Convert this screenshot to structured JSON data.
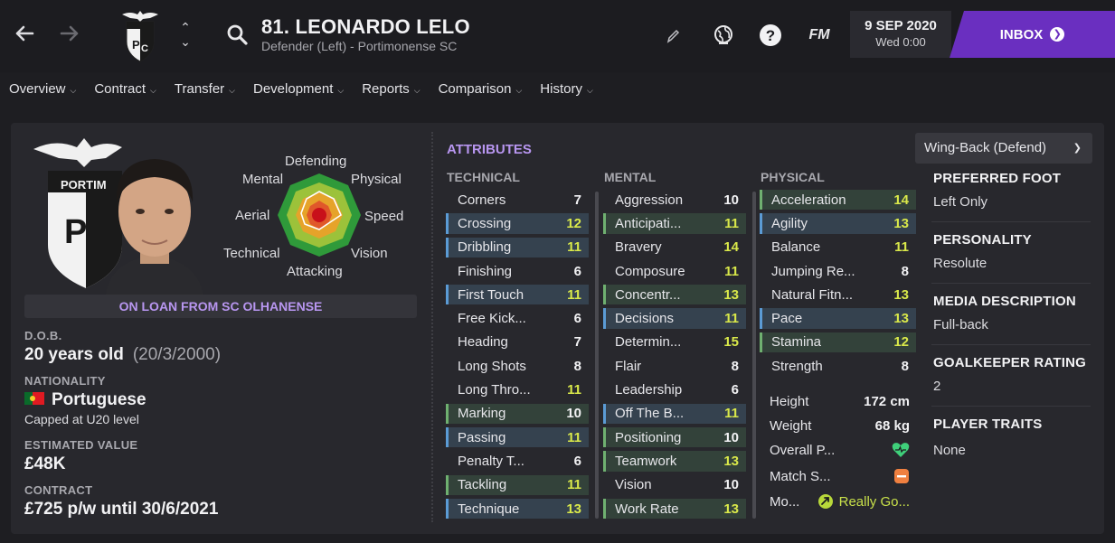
{
  "header": {
    "player_title": "81. LEONARDO LELO",
    "player_sub": "Defender (Left) - Portimonense SC",
    "back_icon": "arrow-left-icon",
    "forward_icon": "arrow-right-icon",
    "fm_label": "FM",
    "date": "9 SEP 2020",
    "time": "Wed 0:00",
    "inbox_label": "INBOX"
  },
  "menu": [
    {
      "label": "Overview"
    },
    {
      "label": "Contract"
    },
    {
      "label": "Transfer"
    },
    {
      "label": "Development"
    },
    {
      "label": "Reports"
    },
    {
      "label": "Comparison"
    },
    {
      "label": "History"
    }
  ],
  "radar": {
    "labels": {
      "defending": "Defending",
      "mental": "Mental",
      "physical": "Physical",
      "aerial": "Aerial",
      "speed": "Speed",
      "technical": "Technical",
      "vision": "Vision",
      "attacking": "Attacking"
    }
  },
  "profile": {
    "loan_text": "ON LOAN FROM SC OLHANENSE",
    "dob_label": "D.O.B.",
    "age": "20 years old",
    "dob": "(20/3/2000)",
    "nationality_label": "NATIONALITY",
    "nationality": "Portuguese",
    "capped": "Capped at U20 level",
    "value_label": "ESTIMATED VALUE",
    "value": "£48K",
    "contract_label": "CONTRACT",
    "contract": "£725 p/w until 30/6/2021"
  },
  "attributes": {
    "title": "ATTRIBUTES",
    "technical_label": "TECHNICAL",
    "mental_label": "MENTAL",
    "physical_label": "PHYSICAL",
    "technical": [
      {
        "name": "Corners",
        "value": "7",
        "hl": "",
        "c": "white"
      },
      {
        "name": "Crossing",
        "value": "12",
        "hl": "blue",
        "c": "yellow"
      },
      {
        "name": "Dribbling",
        "value": "11",
        "hl": "blue",
        "c": "yellow"
      },
      {
        "name": "Finishing",
        "value": "6",
        "hl": "",
        "c": "white"
      },
      {
        "name": "First Touch",
        "value": "11",
        "hl": "blue",
        "c": "yellow"
      },
      {
        "name": "Free Kick...",
        "value": "6",
        "hl": "",
        "c": "white"
      },
      {
        "name": "Heading",
        "value": "7",
        "hl": "",
        "c": "white"
      },
      {
        "name": "Long Shots",
        "value": "8",
        "hl": "",
        "c": "white"
      },
      {
        "name": "Long Thro...",
        "value": "11",
        "hl": "",
        "c": "yellow"
      },
      {
        "name": "Marking",
        "value": "10",
        "hl": "green",
        "c": "white"
      },
      {
        "name": "Passing",
        "value": "11",
        "hl": "blue",
        "c": "yellow"
      },
      {
        "name": "Penalty T...",
        "value": "6",
        "hl": "",
        "c": "white"
      },
      {
        "name": "Tackling",
        "value": "11",
        "hl": "green",
        "c": "yellow"
      },
      {
        "name": "Technique",
        "value": "13",
        "hl": "blue",
        "c": "yellow"
      }
    ],
    "mental": [
      {
        "name": "Aggression",
        "value": "10",
        "hl": "",
        "c": "white"
      },
      {
        "name": "Anticipati...",
        "value": "11",
        "hl": "green",
        "c": "yellow"
      },
      {
        "name": "Bravery",
        "value": "14",
        "hl": "",
        "c": "yellow"
      },
      {
        "name": "Composure",
        "value": "11",
        "hl": "",
        "c": "yellow"
      },
      {
        "name": "Concentr...",
        "value": "13",
        "hl": "green",
        "c": "yellow"
      },
      {
        "name": "Decisions",
        "value": "11",
        "hl": "blue",
        "c": "yellow"
      },
      {
        "name": "Determin...",
        "value": "15",
        "hl": "",
        "c": "yellow"
      },
      {
        "name": "Flair",
        "value": "8",
        "hl": "",
        "c": "white"
      },
      {
        "name": "Leadership",
        "value": "6",
        "hl": "",
        "c": "white"
      },
      {
        "name": "Off The B...",
        "value": "11",
        "hl": "blue",
        "c": "yellow"
      },
      {
        "name": "Positioning",
        "value": "10",
        "hl": "green",
        "c": "white"
      },
      {
        "name": "Teamwork",
        "value": "13",
        "hl": "green",
        "c": "yellow"
      },
      {
        "name": "Vision",
        "value": "10",
        "hl": "",
        "c": "white"
      },
      {
        "name": "Work Rate",
        "value": "13",
        "hl": "green",
        "c": "yellow"
      }
    ],
    "physical": [
      {
        "name": "Acceleration",
        "value": "14",
        "hl": "green",
        "c": "yellow"
      },
      {
        "name": "Agility",
        "value": "13",
        "hl": "blue",
        "c": "yellow"
      },
      {
        "name": "Balance",
        "value": "11",
        "hl": "",
        "c": "yellow"
      },
      {
        "name": "Jumping Re...",
        "value": "8",
        "hl": "",
        "c": "white"
      },
      {
        "name": "Natural Fitn...",
        "value": "13",
        "hl": "",
        "c": "yellow"
      },
      {
        "name": "Pace",
        "value": "13",
        "hl": "blue",
        "c": "yellow"
      },
      {
        "name": "Stamina",
        "value": "12",
        "hl": "green",
        "c": "yellow"
      },
      {
        "name": "Strength",
        "value": "8",
        "hl": "",
        "c": "white"
      }
    ],
    "height_label": "Height",
    "height": "172 cm",
    "weight_label": "Weight",
    "weight": "68 kg",
    "overall_label": "Overall P...",
    "match_label": "Match S...",
    "morale_label": "Mo...",
    "morale_value": "Really Go..."
  },
  "side": {
    "role": "Wing-Back (Defend)",
    "preferred_foot_label": "PREFERRED FOOT",
    "preferred_foot": "Left Only",
    "personality_label": "PERSONALITY",
    "personality": "Resolute",
    "media_label": "MEDIA DESCRIPTION",
    "media": "Full-back",
    "gk_label": "GOALKEEPER RATING",
    "gk": "2",
    "traits_label": "PLAYER TRAITS",
    "traits": "None"
  },
  "colors": {
    "accent": "#6a2fc0",
    "attr_title": "#b896f0",
    "key_blue": "#5b9bd5",
    "key_green": "#6fb070",
    "value_yellow": "#d9e84a",
    "heart_green": "#3fd07a",
    "match_orange": "#f08040"
  }
}
